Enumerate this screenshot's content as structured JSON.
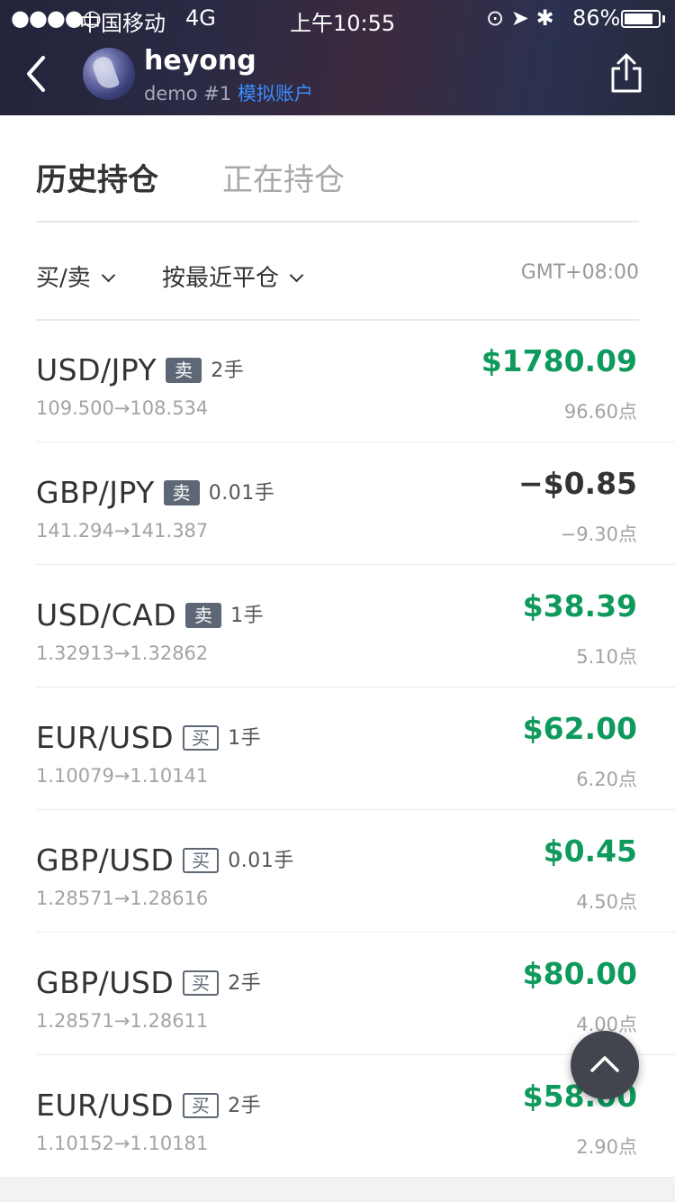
{
  "status_bar": {
    "signal": "●●●●○",
    "carrier": "中国移动",
    "network": "4G",
    "time": "上午10:55",
    "icons": "⊙ ➤ ✱",
    "battery": "86%",
    "battery_level": 0.86
  },
  "header": {
    "username": "heyong",
    "account_prefix": "demo #1",
    "account_type": "模拟账户"
  },
  "tabs": [
    {
      "label": "历史持仓",
      "active": true
    },
    {
      "label": "正在持仓",
      "active": false
    }
  ],
  "filters": {
    "side_label": "买/卖",
    "sort_label": "按最近平仓",
    "timezone": "GMT+08:00"
  },
  "positions": [
    {
      "pair": "USD/JPY",
      "side": "卖",
      "lots": "2手",
      "prices": "109.500→108.534",
      "profit": "$1780.09",
      "points": "96.60点"
    },
    {
      "pair": "GBP/JPY",
      "side": "卖",
      "lots": "0.01手",
      "prices": "141.294→141.387",
      "profit": "−$0.85",
      "points": "−9.30点"
    },
    {
      "pair": "USD/CAD",
      "side": "卖",
      "lots": "1手",
      "prices": "1.32913→1.32862",
      "profit": "$38.39",
      "points": "5.10点"
    },
    {
      "pair": "EUR/USD",
      "side": "买",
      "lots": "1手",
      "prices": "1.10079→1.10141",
      "profit": "$62.00",
      "points": "6.20点"
    },
    {
      "pair": "GBP/USD",
      "side": "买",
      "lots": "0.01手",
      "prices": "1.28571→1.28616",
      "profit": "$0.45",
      "points": "4.50点"
    },
    {
      "pair": "GBP/USD",
      "side": "买",
      "lots": "2手",
      "prices": "1.28571→1.28611",
      "profit": "$80.00",
      "points": "4.00点"
    },
    {
      "pair": "EUR/USD",
      "side": "买",
      "lots": "2手",
      "prices": "1.10152→1.10181",
      "profit": "$58.00",
      "points": "2.90点"
    }
  ],
  "colors": {
    "profit_positive": "#0f9a5d",
    "profit_negative": "#333333",
    "account_type": "#3b8cff",
    "sell_badge": "#5d6775"
  },
  "icons": {
    "back": "chevron-left-icon",
    "share": "share-icon",
    "scroll_top": "chevron-up-icon"
  }
}
